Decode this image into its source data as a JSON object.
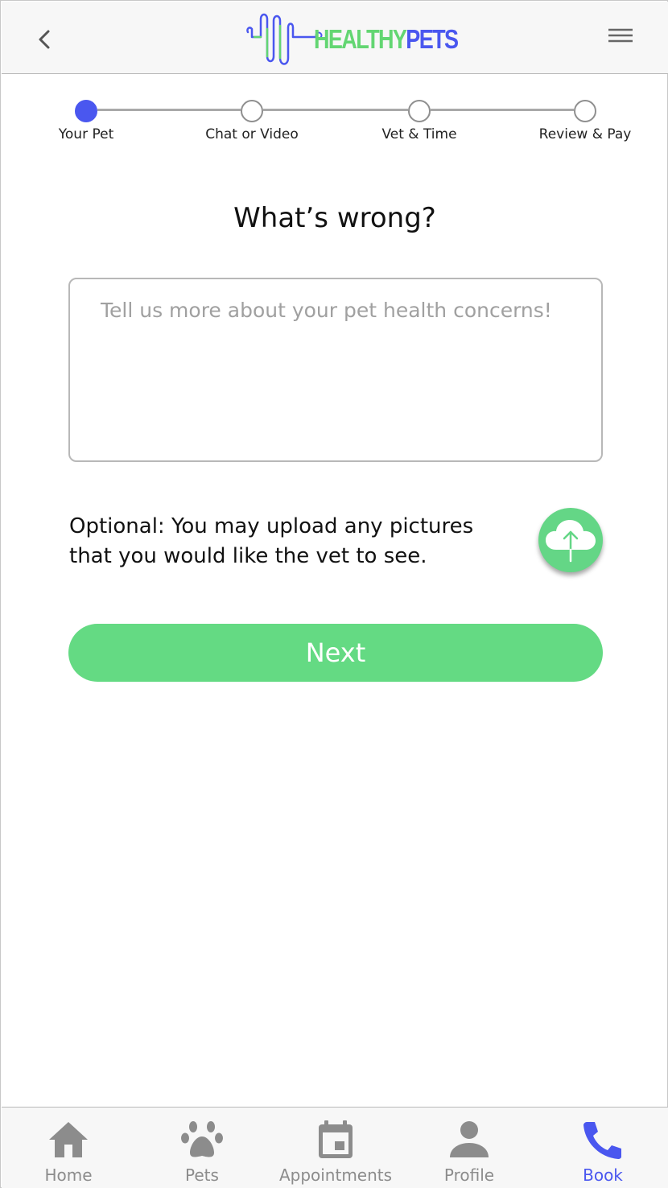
{
  "header": {
    "logo_part1": "HEALTHY",
    "logo_part2": "PETS",
    "back_icon": "chevron-left-icon",
    "menu_icon": "hamburger-menu-icon"
  },
  "stepper": {
    "steps": [
      {
        "label": "Your Pet",
        "active": true
      },
      {
        "label": "Chat or Video",
        "active": false
      },
      {
        "label": "Vet & Time",
        "active": false
      },
      {
        "label": "Review & Pay",
        "active": false
      }
    ]
  },
  "main": {
    "title": "What’s wrong?",
    "concern_placeholder": "Tell us more about your pet health concerns!",
    "concern_value": "",
    "optional_text": "Optional: You may upload any pictures that you would like the vet to see.",
    "upload_icon": "cloud-upload-icon",
    "next_label": "Next"
  },
  "bottom_nav": {
    "items": [
      {
        "label": "Home",
        "icon": "home-icon",
        "active": false
      },
      {
        "label": "Pets",
        "icon": "paw-icon",
        "active": false
      },
      {
        "label": "Appointments",
        "icon": "calendar-icon",
        "active": false
      },
      {
        "label": "Profile",
        "icon": "person-icon",
        "active": false
      },
      {
        "label": "Book",
        "icon": "phone-icon",
        "active": true
      }
    ]
  },
  "colors": {
    "brand_blue": "#4a57ef",
    "brand_green": "#63d672",
    "button_green": "#64da83",
    "inactive_gray": "#8c8c8c"
  }
}
